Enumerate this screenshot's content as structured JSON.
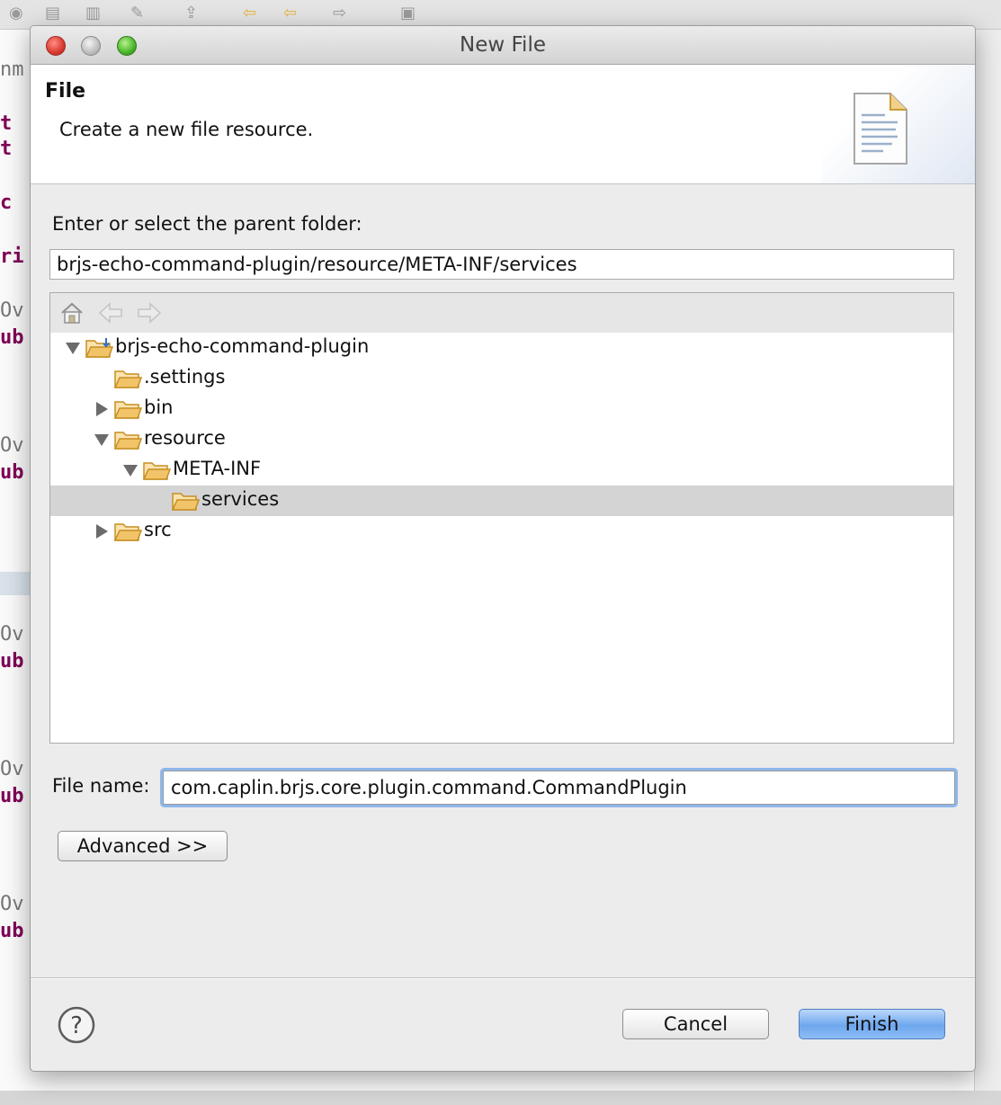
{
  "dialog": {
    "title": "New File",
    "page_title": "File",
    "page_description": "Create a new file resource.",
    "folder_label": "Enter or select the parent folder:",
    "folder_path": "brjs-echo-command-plugin/resource/META-INF/services",
    "tree": {
      "items": [
        {
          "label": "brjs-echo-command-plugin",
          "depth": 0,
          "expanded": true,
          "has_children": true,
          "icon": "project-folder-icon",
          "selected": false
        },
        {
          "label": ".settings",
          "depth": 1,
          "expanded": false,
          "has_children": false,
          "icon": "folder-icon",
          "selected": false
        },
        {
          "label": "bin",
          "depth": 1,
          "expanded": false,
          "has_children": true,
          "icon": "folder-icon",
          "selected": false
        },
        {
          "label": "resource",
          "depth": 1,
          "expanded": true,
          "has_children": true,
          "icon": "folder-icon",
          "selected": false
        },
        {
          "label": "META-INF",
          "depth": 2,
          "expanded": true,
          "has_children": true,
          "icon": "folder-icon",
          "selected": false
        },
        {
          "label": "services",
          "depth": 3,
          "expanded": false,
          "has_children": false,
          "icon": "folder-icon",
          "selected": true
        },
        {
          "label": "src",
          "depth": 1,
          "expanded": false,
          "has_children": true,
          "icon": "folder-icon",
          "selected": false
        }
      ]
    },
    "file_name_label": "File name:",
    "file_name_value": "com.caplin.brjs.core.plugin.command.CommandPlugin",
    "advanced_label": "Advanced >>",
    "cancel_label": "Cancel",
    "finish_label": "Finish"
  },
  "background_editor": {
    "fragments": [
      "nm",
      "t",
      "t",
      "c",
      "ri",
      "Ov",
      "ub",
      "Ov",
      "ub",
      "Ov",
      "ub",
      "Ov",
      "ub",
      "Ov",
      "ub"
    ]
  },
  "colors": {
    "selection": "#d4d4d4",
    "finish_button": "#6ea7ee",
    "focus_ring": "#8fb7ea",
    "folder": "#f2c46a"
  }
}
